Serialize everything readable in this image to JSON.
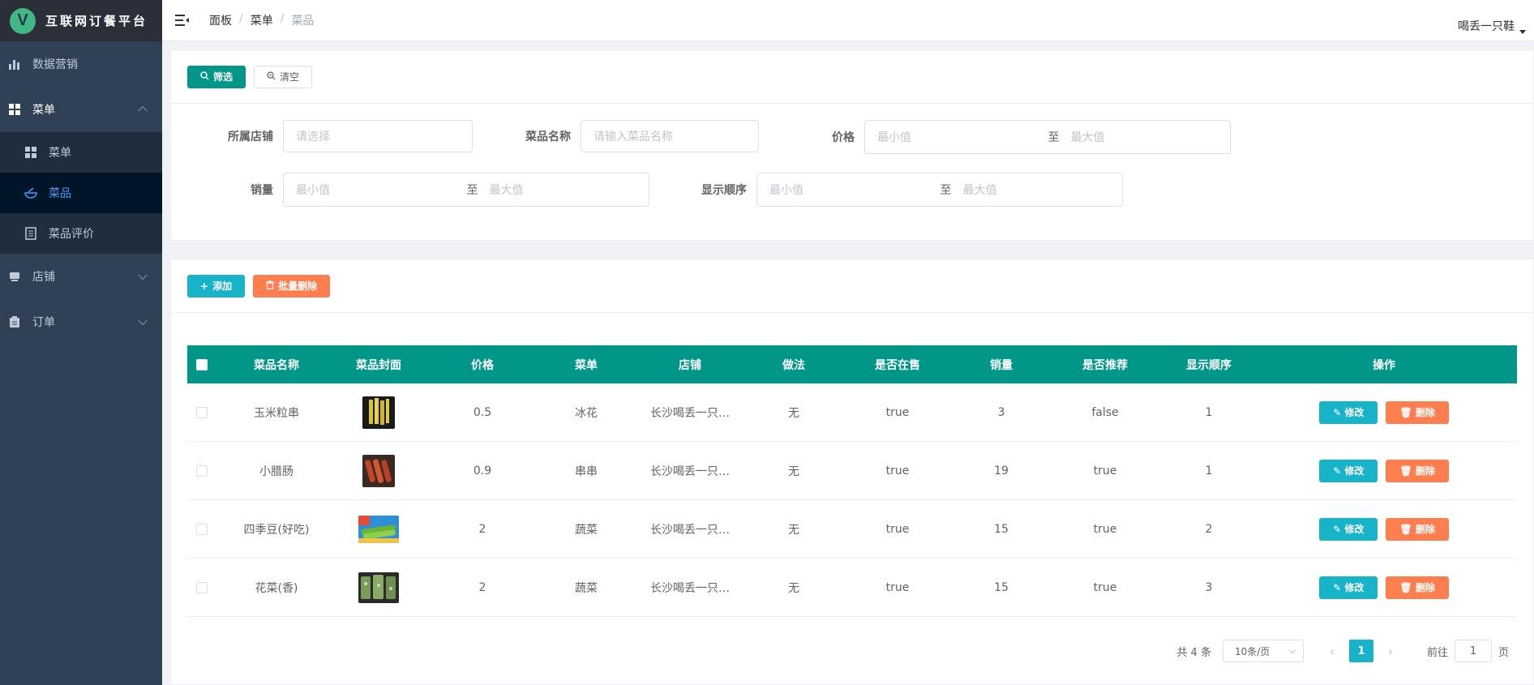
{
  "app": {
    "logo_letter": "V",
    "title": "互联网订餐平台"
  },
  "sidebar": {
    "items": [
      {
        "label": "数据营销"
      },
      {
        "label": "菜单",
        "children": [
          {
            "label": "菜单"
          },
          {
            "label": "菜品"
          },
          {
            "label": "菜品评价"
          }
        ]
      },
      {
        "label": "店铺"
      },
      {
        "label": "订单"
      }
    ]
  },
  "navbar": {
    "breadcrumb": [
      "面板",
      "菜单",
      "菜品"
    ],
    "breadcrumb_sep": "/",
    "user": "喝丢一只鞋"
  },
  "filter": {
    "btn_filter": "筛选",
    "btn_clear": "清空",
    "shop_label": "所属店铺",
    "shop_placeholder": "请选择",
    "name_label": "菜品名称",
    "name_placeholder": "请输入菜品名称",
    "price_label": "价格",
    "sales_label": "销量",
    "order_label": "显示顺序",
    "min_ph": "最小值",
    "max_ph": "最大值",
    "to": "至"
  },
  "table": {
    "btn_add": "添加",
    "btn_batch_delete": "批量删除",
    "headers": [
      "菜品名称",
      "菜品封面",
      "价格",
      "菜单",
      "店铺",
      "做法",
      "是否在售",
      "销量",
      "是否推荐",
      "显示顺序",
      "操作"
    ],
    "rows": [
      {
        "name": "玉米粒串",
        "price": "0.5",
        "menu": "冰花",
        "shop": "长沙喝丢一只…",
        "method": "无",
        "on_sale": "true",
        "sales": "3",
        "recommend": "false",
        "order": "1"
      },
      {
        "name": "小腊肠",
        "price": "0.9",
        "menu": "串串",
        "shop": "长沙喝丢一只…",
        "method": "无",
        "on_sale": "true",
        "sales": "19",
        "recommend": "true",
        "order": "1"
      },
      {
        "name": "四季豆(好吃)",
        "price": "2",
        "menu": "蔬菜",
        "shop": "长沙喝丢一只…",
        "method": "无",
        "on_sale": "true",
        "sales": "15",
        "recommend": "true",
        "order": "2"
      },
      {
        "name": "花菜(香)",
        "price": "2",
        "menu": "蔬菜",
        "shop": "长沙喝丢一只…",
        "method": "无",
        "on_sale": "true",
        "sales": "15",
        "recommend": "true",
        "order": "3"
      }
    ],
    "edit_label": "修改",
    "delete_label": "删除"
  },
  "pagination": {
    "total": "共 4 条",
    "page_size": "10条/页",
    "current": "1",
    "goto_prefix": "前往",
    "goto_value": "1",
    "goto_suffix": "页"
  },
  "colors": {
    "primary": "#009688",
    "cyan": "#17b3c9",
    "orange": "#ff7e4f",
    "sidebar": "#304156",
    "active_text": "#409eff"
  }
}
